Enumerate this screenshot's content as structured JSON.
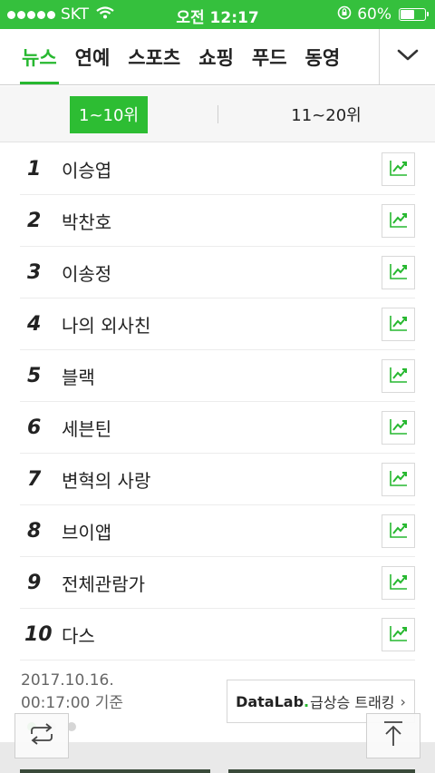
{
  "status_bar": {
    "carrier": "SKT",
    "time": "오전 12:17",
    "battery_text": "60%",
    "battery_level": 0.6
  },
  "tabs": {
    "items": [
      {
        "label": "뉴스",
        "active": true
      },
      {
        "label": "연예",
        "active": false
      },
      {
        "label": "스포츠",
        "active": false
      },
      {
        "label": "쇼핑",
        "active": false
      },
      {
        "label": "푸드",
        "active": false
      },
      {
        "label": "동영",
        "active": false
      }
    ],
    "more_icon": "chevron-down-icon"
  },
  "range": {
    "first": "1~10위",
    "second": "11~20위",
    "selected": "1~10위"
  },
  "ranking": [
    {
      "rank": "1",
      "keyword": "이승엽"
    },
    {
      "rank": "2",
      "keyword": "박찬호"
    },
    {
      "rank": "3",
      "keyword": "이송정"
    },
    {
      "rank": "4",
      "keyword": "나의 외사친"
    },
    {
      "rank": "5",
      "keyword": "블랙"
    },
    {
      "rank": "6",
      "keyword": "세븐틴"
    },
    {
      "rank": "7",
      "keyword": "변혁의 사랑"
    },
    {
      "rank": "8",
      "keyword": "브이앱"
    },
    {
      "rank": "9",
      "keyword": "전체관람가"
    },
    {
      "rank": "10",
      "keyword": "다스"
    }
  ],
  "footer": {
    "date": "2017.10.16.",
    "time_basis": "00:17:00 기준",
    "datalab_brand": "DataLab",
    "datalab_dot": ".",
    "datalab_label": "급상승 트래킹",
    "datalab_chevron": "›"
  },
  "pager": {
    "count": 3,
    "active_index": 0
  },
  "colors": {
    "accent": "#27b830",
    "status_bar": "#35c03d",
    "selected_segment": "#2dbd33"
  }
}
